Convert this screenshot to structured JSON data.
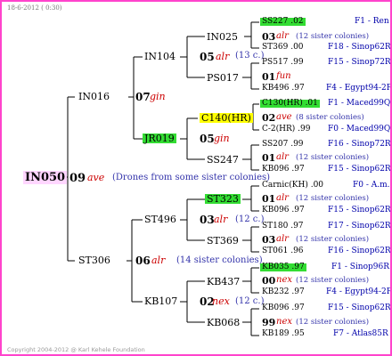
{
  "date": "18-6-2012 ( 0:30)",
  "copyright": "Copyright 2004-2012 @ Karl Kehele Foundation",
  "root": {
    "name": "IN050",
    "gen": "09",
    "race": "ave",
    "note": "(Drones from some sister colonies)"
  },
  "sire": {
    "name": "IN016",
    "gen": "07",
    "race": "gin"
  },
  "dam": {
    "name": "ST306",
    "gen": "06",
    "race": "alr",
    "note": "(14 sister colonies)"
  },
  "ss": {
    "name": "IN104",
    "gen": "05",
    "race": "alr",
    "note": "(13 c.)"
  },
  "sd": {
    "name": "JR019",
    "gen": "05",
    "race": "gin"
  },
  "ds": {
    "name": "ST496",
    "gen": "03",
    "race": "alr",
    "note": "(12 c.)"
  },
  "dd": {
    "name": "KB107",
    "gen": "02",
    "race": "nex",
    "note": "(12 c.)"
  },
  "l3": [
    {
      "name": "IN025"
    },
    {
      "name": "PS017"
    },
    {
      "name": "C140(HR)"
    },
    {
      "name": "SS247"
    },
    {
      "name": "ST323"
    },
    {
      "name": "ST369"
    },
    {
      "name": "KB437"
    },
    {
      "name": "KB068"
    }
  ],
  "l4": [
    {
      "name": "SS227 .02",
      "code": "F1 - Ren"
    },
    {
      "gen": "03",
      "race": "alr",
      "cnt": "(12 sister colonies)"
    },
    {
      "name": "ST369 .00",
      "code": "F18 - Sinop62R"
    },
    {
      "name": "PS517 .99",
      "code": "F15 - Sinop72R"
    },
    {
      "gen": "01",
      "race": "fun"
    },
    {
      "name": "KB496 .97",
      "code": "F4 - Egypt94-2R"
    },
    {
      "name": "C130(HR) .01",
      "code": "F1 - Maced99Q"
    },
    {
      "gen": "02",
      "race": "ave",
      "cnt": "(8 sister colonies)"
    },
    {
      "name": "C-2(HR) .99",
      "code": "F0 - Maced99Q"
    },
    {
      "name": "SS207 .99",
      "code": "F16 - Sinop72R"
    },
    {
      "gen": "01",
      "race": "alr",
      "cnt": "(12 sister colonies)"
    },
    {
      "name": "KB096 .97",
      "code": "F15 - Sinop62R"
    },
    {
      "name": "Carnic(KH) .00",
      "code": "F0 - A.m."
    },
    {
      "gen": "01",
      "race": "alr",
      "cnt": "(12 sister colonies)"
    },
    {
      "name": "KB096 .97",
      "code": "F15 - Sinop62R"
    },
    {
      "name": "ST180 .97",
      "code": "F17 - Sinop62R"
    },
    {
      "gen": "03",
      "race": "alr",
      "cnt": "(12 sister colonies)"
    },
    {
      "name": "ST061 .96",
      "code": "F16 - Sinop62R"
    },
    {
      "name": "KB035 .97",
      "code": "F1 - Sinop96R"
    },
    {
      "gen": "00",
      "race": "nex",
      "cnt": "(12 sister colonies)"
    },
    {
      "name": "KB232 .97",
      "code": "F4 - Egypt94-2R"
    },
    {
      "name": "KB096 .97",
      "code": "F15 - Sinop62R"
    },
    {
      "gen": "99",
      "race": "nex",
      "cnt": "(12 sister colonies)"
    },
    {
      "name": "KB189 .95",
      "code": "F7 - Atlas85R"
    }
  ]
}
